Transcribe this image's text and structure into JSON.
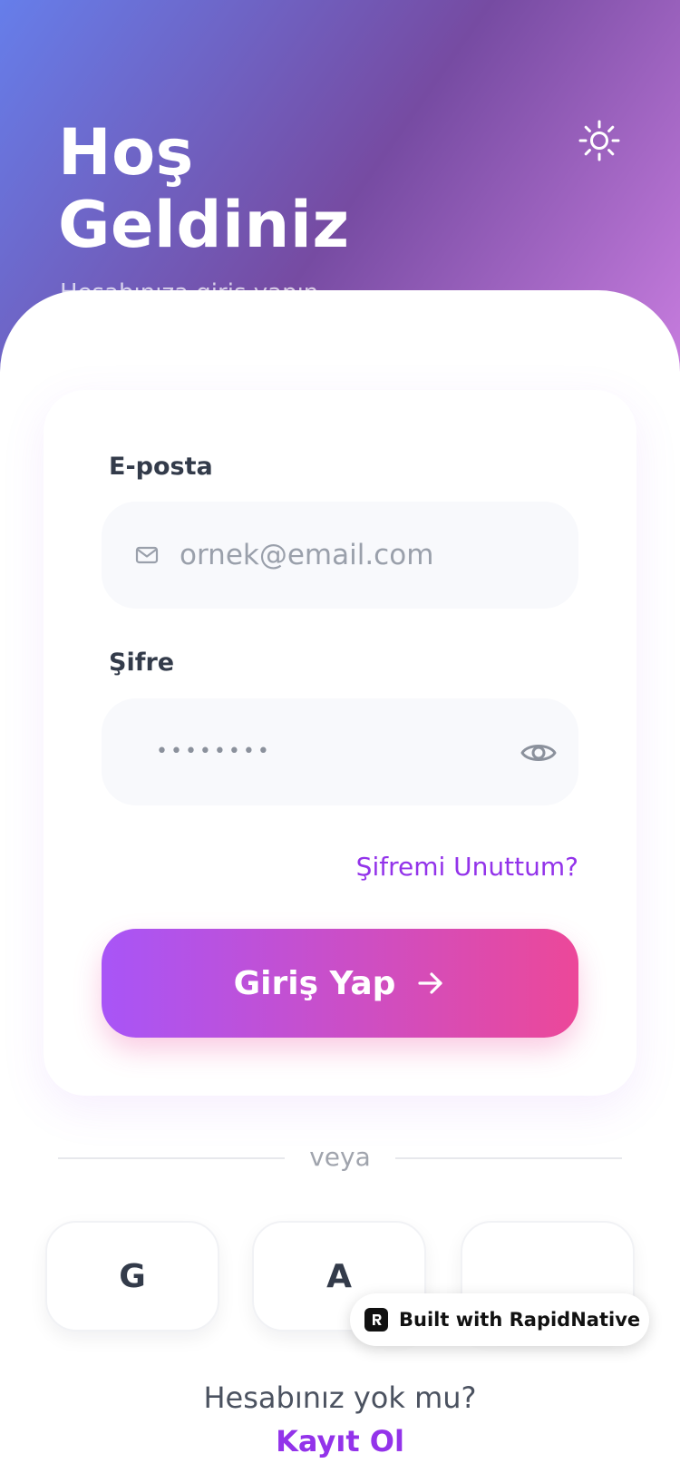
{
  "header": {
    "title_line1": "Hoş",
    "title_line2": "Geldiniz",
    "subtitle": "Hesabınıza giriş yapın",
    "theme_icon": "sun-icon"
  },
  "form": {
    "email": {
      "label": "E-posta",
      "placeholder": "ornek@email.com",
      "icon": "mail-icon"
    },
    "password": {
      "label": "Şifre",
      "masked_value": "••••••••",
      "toggle_icon": "eye-icon"
    },
    "forgot_password": "Şifremi Unuttum?",
    "submit": {
      "label": "Giriş Yap",
      "icon": "arrow-right-icon"
    }
  },
  "divider": {
    "label": "veya"
  },
  "social": [
    {
      "letter": "G"
    },
    {
      "letter": "A"
    },
    {
      "letter": ""
    }
  ],
  "badge": {
    "label": "Built with RapidNative"
  },
  "footer": {
    "prompt": "Hesabınız yok mu?",
    "signup": "Kayıt Ol"
  },
  "colors": {
    "accent": "#9333ea",
    "gradient_start": "#a855f7",
    "gradient_end": "#ec4899",
    "hero_start": "#667eea",
    "hero_mid": "#764ba2"
  }
}
